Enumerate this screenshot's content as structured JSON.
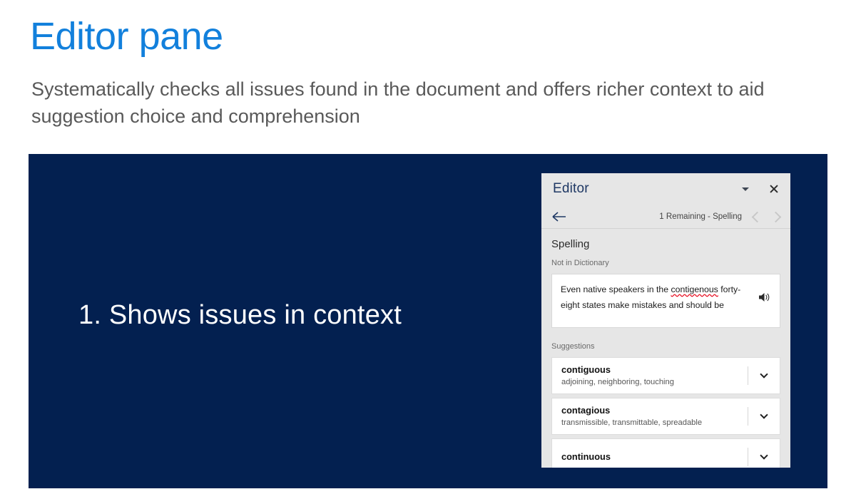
{
  "slide": {
    "title": "Editor pane",
    "subtitle": "Systematically checks all issues found in the document and offers richer context to aid suggestion choice and comprehension",
    "callout": "1. Shows issues in context",
    "title_color": "#1280DC",
    "subtitle_color": "#595959",
    "panel_color": "#032050"
  },
  "editor_pane": {
    "title": "Editor",
    "header_icons": {
      "dropdown": "caret-down-icon",
      "close": "close-icon"
    },
    "nav": {
      "back_icon": "back-arrow-icon",
      "status": "1 Remaining - Spelling",
      "prev_icon": "chevron-left-icon",
      "next_icon": "chevron-right-icon"
    },
    "section_title": "Spelling",
    "not_in_dictionary_label": "Not in Dictionary",
    "context": {
      "before": "Even native speakers in the ",
      "error_word": "contigenous",
      "after": " forty-eight states make mistakes and should be",
      "error_underline_color": "#E81123",
      "read_aloud_icon": "speaker-icon"
    },
    "suggestions_label": "Suggestions",
    "suggestions": [
      {
        "word": "contiguous",
        "synonyms": "adjoining, neighboring, touching",
        "expand_icon": "chevron-down-icon"
      },
      {
        "word": "contagious",
        "synonyms": "transmissible, transmittable, spreadable",
        "expand_icon": "chevron-down-icon"
      },
      {
        "word": "continuous",
        "synonyms": "",
        "expand_icon": "chevron-down-icon"
      }
    ],
    "background_color": "#E6E6E6"
  }
}
